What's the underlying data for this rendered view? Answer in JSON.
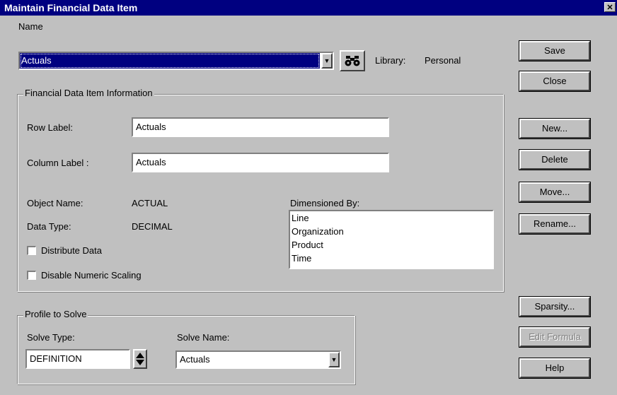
{
  "window": {
    "title": "Maintain Financial Data Item",
    "close_glyph": "✕"
  },
  "name_section": {
    "label": "Name",
    "value": "Actuals",
    "library_label": "Library:",
    "library_value": "Personal"
  },
  "info_group": {
    "title": "Financial Data Item Information",
    "row_label_label": "Row Label:",
    "row_label_value": "Actuals",
    "column_label_label": "Column Label :",
    "column_label_value": "Actuals",
    "object_name_label": "Object Name:",
    "object_name_value": "ACTUAL",
    "data_type_label": "Data Type:",
    "data_type_value": "DECIMAL",
    "distribute_label": "Distribute Data",
    "disable_scaling_label": "Disable Numeric Scaling",
    "dimensioned_by_label": "Dimensioned By:",
    "dimensions": [
      "Line",
      "Organization",
      "Product",
      "Time"
    ]
  },
  "profile_group": {
    "title": "Profile to Solve",
    "solve_type_label": "Solve Type:",
    "solve_type_value": "DEFINITION",
    "solve_name_label": "Solve Name:",
    "solve_name_value": "Actuals"
  },
  "buttons": {
    "save": "Save",
    "close": "Close",
    "new": "New...",
    "delete": "Delete",
    "move": "Move...",
    "rename": "Rename...",
    "sparsity": "Sparsity...",
    "edit_formula": "Edit Formula",
    "help": "Help"
  },
  "icons": {
    "find": "binoculars-icon",
    "dropdown": "triangle-down-icon",
    "spinner": "up-down-arrows-icon"
  },
  "colors": {
    "titlebar": "#000080",
    "selection": "#000080",
    "face": "#c0c0c0"
  }
}
